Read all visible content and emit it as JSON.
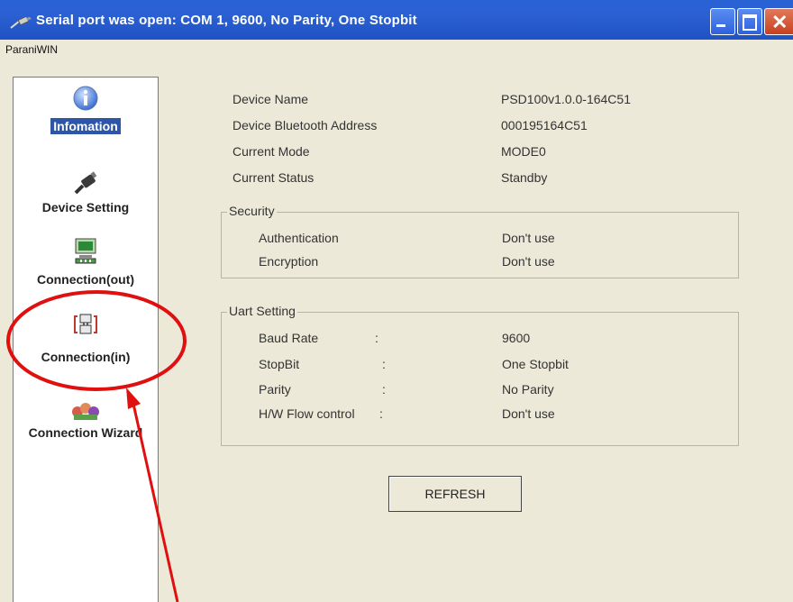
{
  "window": {
    "title": "Serial port was open: COM 1, 9600, No Parity, One Stopbit"
  },
  "menu": {
    "items": [
      "ParaniWIN"
    ]
  },
  "sidebar": {
    "items": [
      {
        "label": "Infomation",
        "icon": "info-icon",
        "selected": true
      },
      {
        "label": "Device Setting",
        "icon": "device-setting-icon",
        "selected": false
      },
      {
        "label": "Connection(out)",
        "icon": "connection-out-icon",
        "selected": false
      },
      {
        "label": "Connection(in)",
        "icon": "connection-in-icon",
        "selected": false
      },
      {
        "label": "Connection Wizard",
        "icon": "connection-wizard-icon",
        "selected": false
      }
    ]
  },
  "info": {
    "device_name_label": "Device Name",
    "device_name_value": "PSD100v1.0.0-164C51",
    "bt_address_label": "Device Bluetooth Address",
    "bt_address_value": "000195164C51",
    "mode_label": "Current Mode",
    "mode_value": "MODE0",
    "status_label": "Current Status",
    "status_value": "Standby"
  },
  "security": {
    "title": "Security",
    "auth_label": "Authentication",
    "auth_value": "Don't use",
    "enc_label": "Encryption",
    "enc_value": "Don't use"
  },
  "uart": {
    "title": "Uart Setting",
    "baud_label": "Baud Rate",
    "baud_value": "9600",
    "stopbit_label": "StopBit",
    "stopbit_value": "One Stopbit",
    "parity_label": "Parity",
    "parity_value": "No Parity",
    "flow_label": "H/W Flow control",
    "flow_value": "Don't use",
    "colon": ":"
  },
  "buttons": {
    "refresh": "REFRESH"
  },
  "colors": {
    "titlebar": "#2a5fd0",
    "selection": "#2d55a8",
    "annotation": "#e01010",
    "window_bg": "#ece9d8"
  }
}
